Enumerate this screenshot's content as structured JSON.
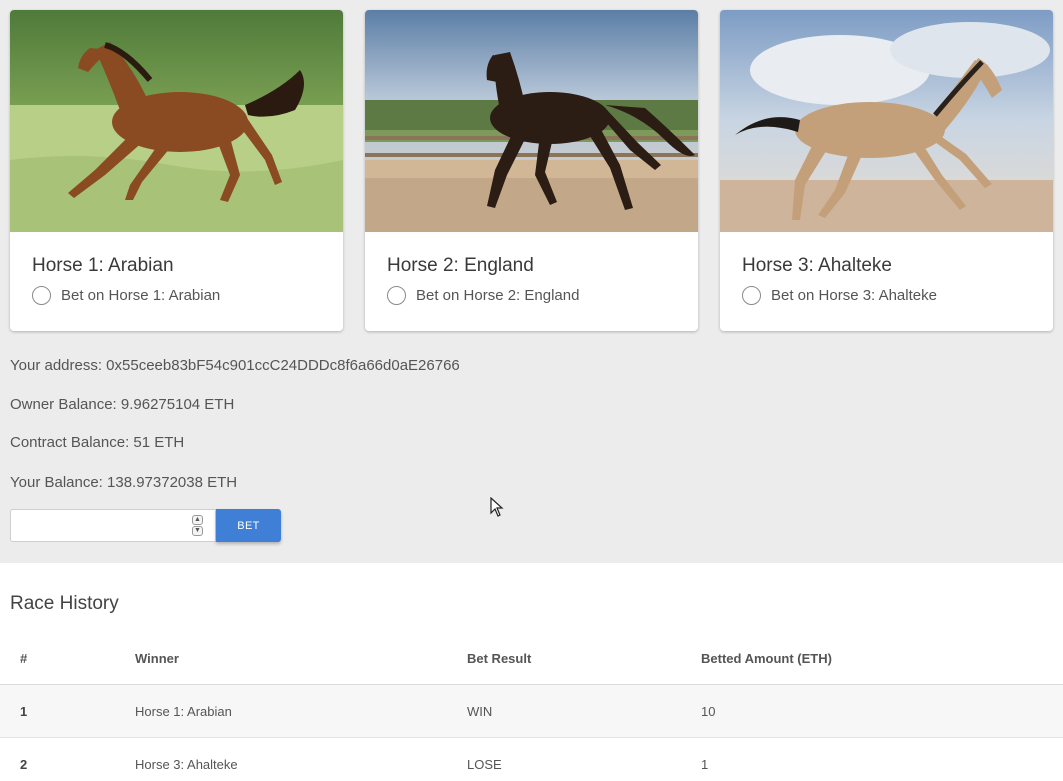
{
  "horses": [
    {
      "title": "Horse 1: Arabian",
      "bet_label": "Bet on Horse 1: Arabian"
    },
    {
      "title": "Horse 2: England",
      "bet_label": "Bet on Horse 2: England"
    },
    {
      "title": "Horse 3: Ahalteke",
      "bet_label": "Bet on Horse 3: Ahalteke"
    }
  ],
  "info": {
    "address": "Your address: 0x55ceeb83bF54c901ccC24DDDc8f6a66d0aE26766",
    "owner_balance": "Owner Balance: 9.96275104 ETH",
    "contract_balance": "Contract Balance: 51 ETH",
    "your_balance": "Your Balance: 138.97372038 ETH"
  },
  "bet_form": {
    "amount_value": "",
    "button_label": "BET"
  },
  "history": {
    "title": "Race History",
    "columns": [
      "#",
      "Winner",
      "Bet Result",
      "Betted Amount (ETH)"
    ],
    "rows": [
      [
        "1",
        "Horse 1: Arabian",
        "WIN",
        "10"
      ],
      [
        "2",
        "Horse 3: Ahalteke",
        "LOSE",
        "1"
      ]
    ]
  },
  "colors": {
    "accent": "#3f7fd6",
    "background": "#ececec"
  },
  "icons": {
    "spin_up": "chevron-up-icon",
    "spin_down": "chevron-down-icon",
    "cursor": "mouse-pointer-icon"
  }
}
